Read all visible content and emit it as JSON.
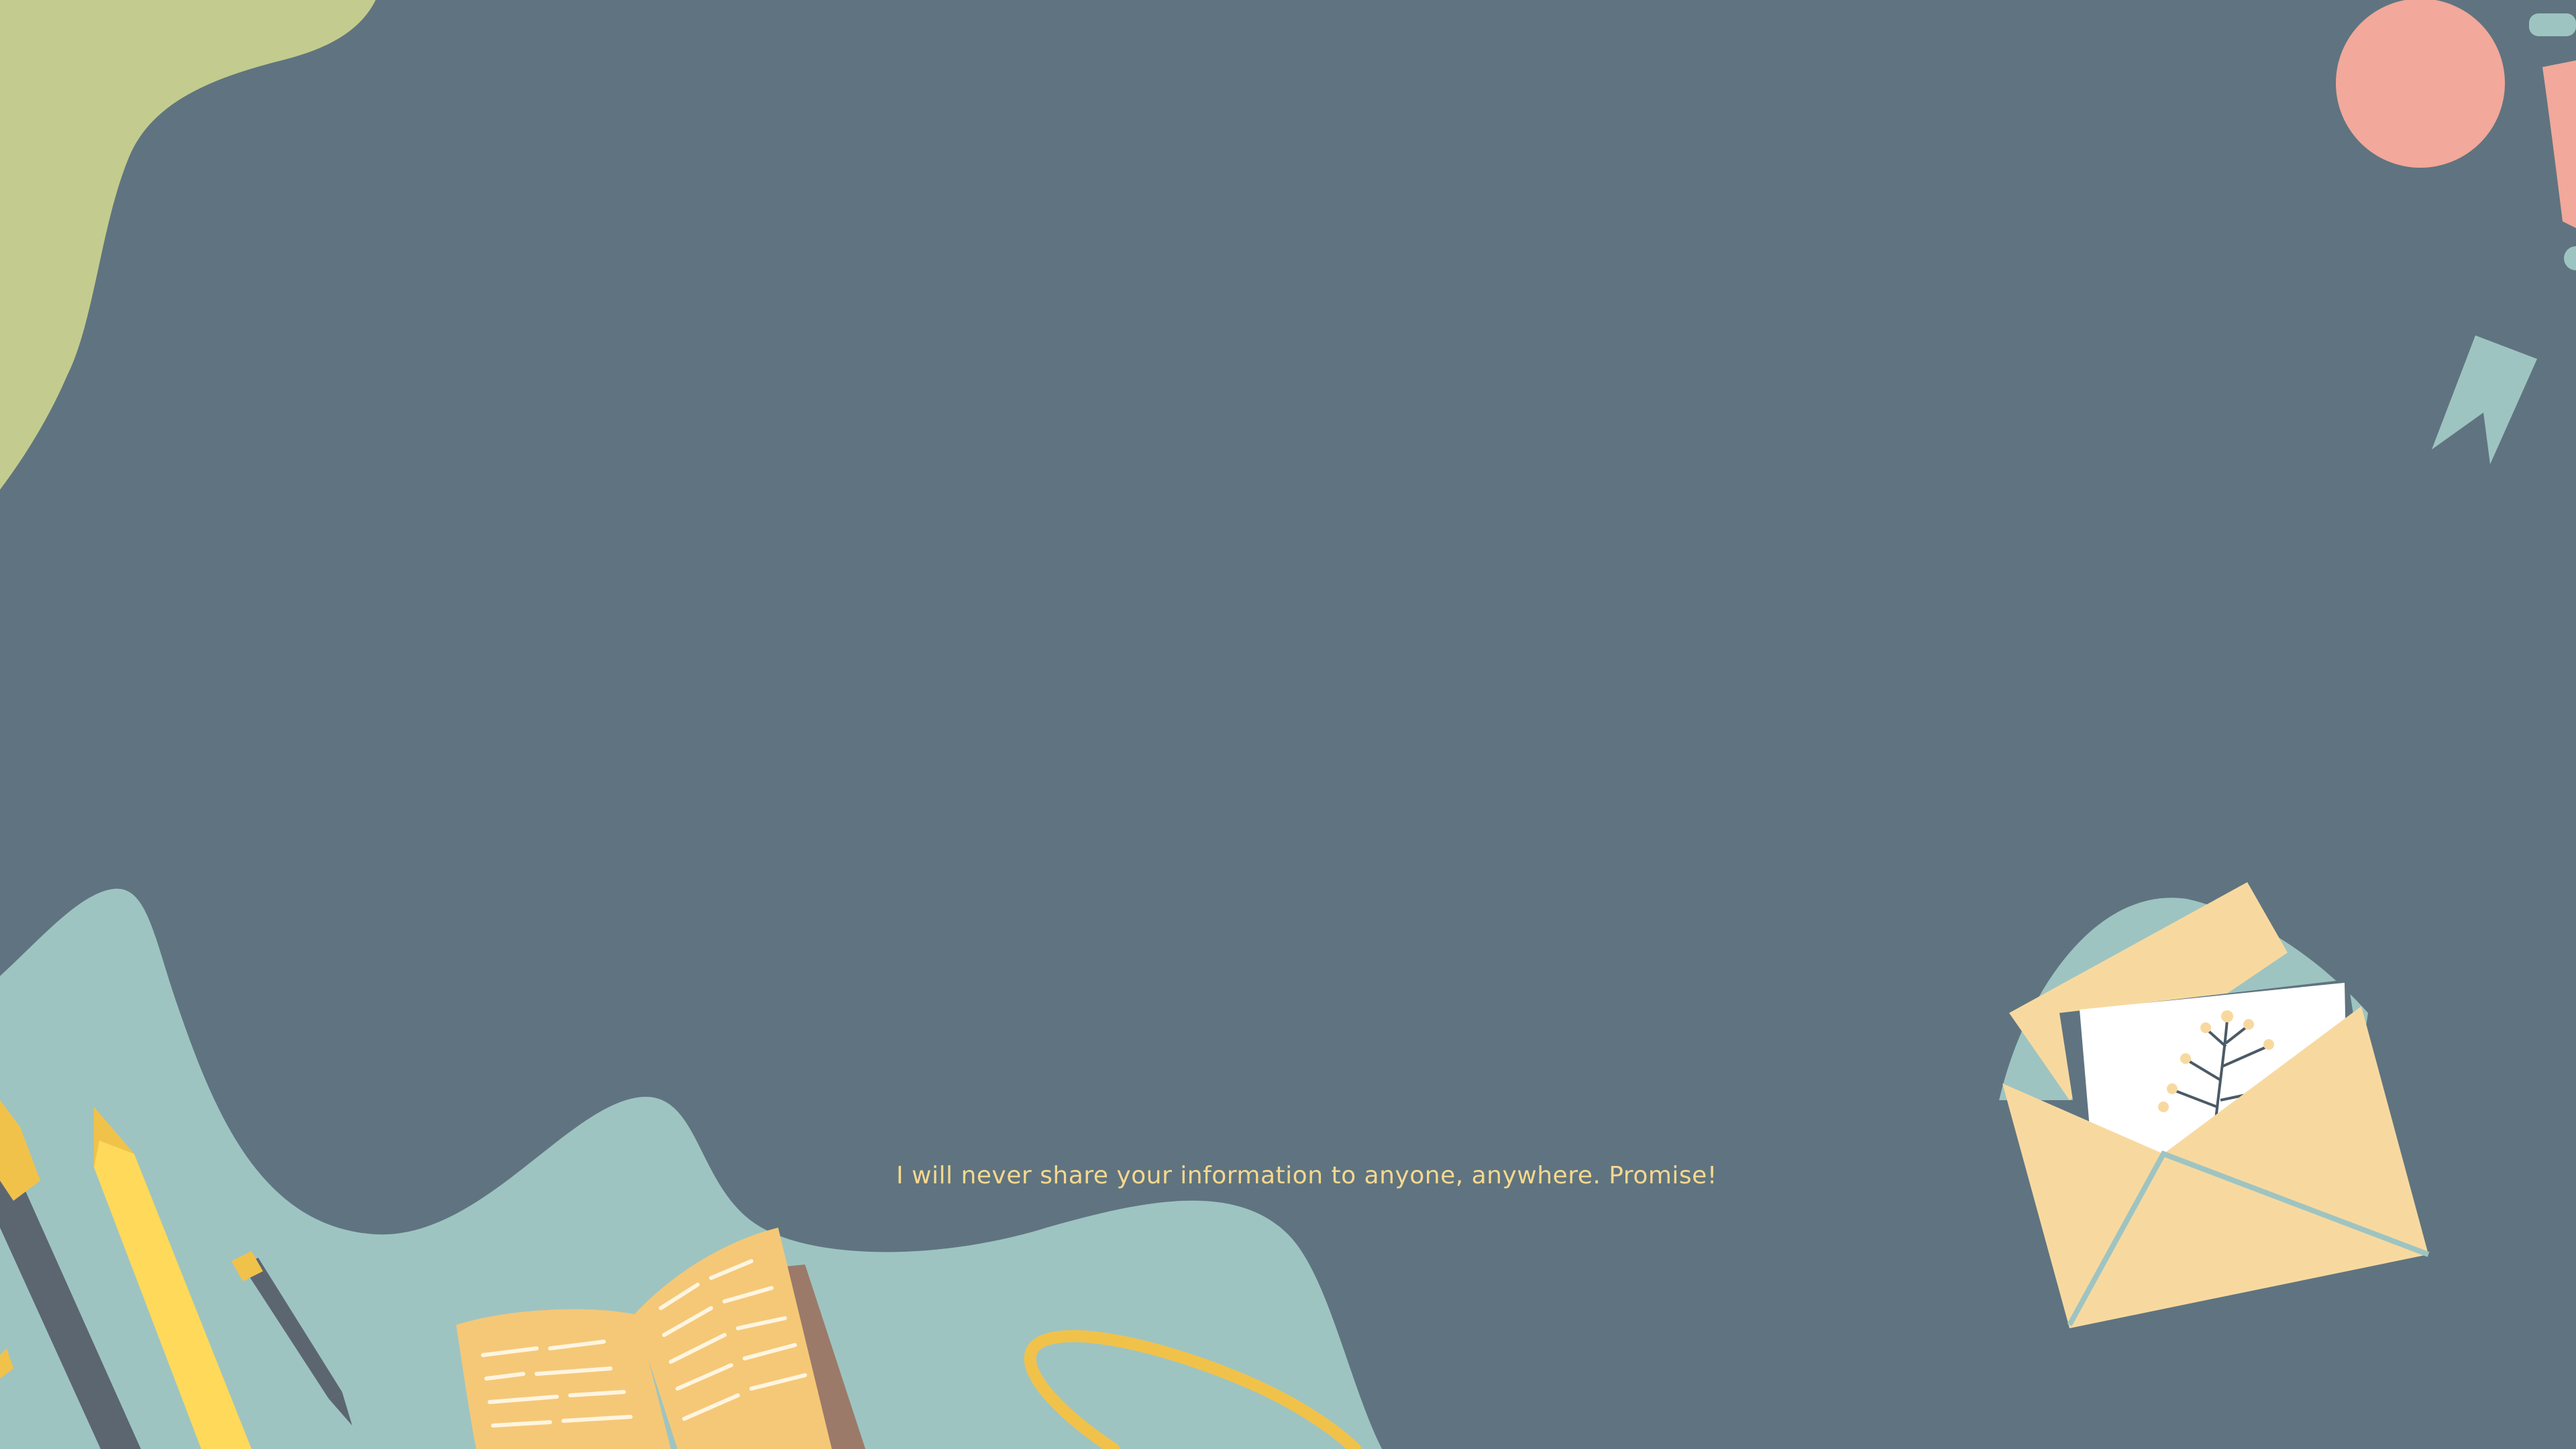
{
  "page": {
    "message": "I will never share your information to anyone, anywhere. Promise!"
  },
  "decorations": [
    "green-blob-top-left",
    "pink-circle-top-right",
    "teal-bookmark-top-right",
    "teal-wave-bottom",
    "pencils",
    "open-notebook",
    "yellow-ring",
    "envelope-with-card"
  ],
  "colors": {
    "background": "#5f7480",
    "green_blob": "#c3cc8e",
    "pink": "#f2a89a",
    "teal": "#9ec4c1",
    "sand": "#f7d9a0",
    "yellow": "#f1c24a",
    "text": "#f7d88e"
  }
}
